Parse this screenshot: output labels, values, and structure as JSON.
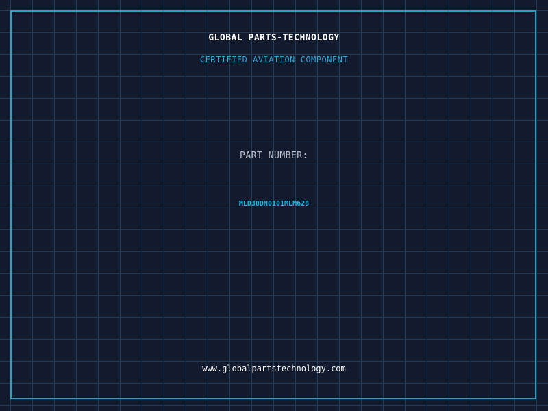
{
  "header": {
    "brand": "GLOBAL PARTS-TECHNOLOGY",
    "subtitle": "CERTIFIED AVIATION COMPONENT"
  },
  "part": {
    "label": "PART NUMBER:",
    "number": "MLD30DN0101MLM628"
  },
  "footer": {
    "website": "www.globalpartstechnology.com"
  },
  "colors": {
    "background": "#121a2e",
    "grid": "#1f3d57",
    "accent": "#16b9e6",
    "frame": "#1ba4c8"
  }
}
